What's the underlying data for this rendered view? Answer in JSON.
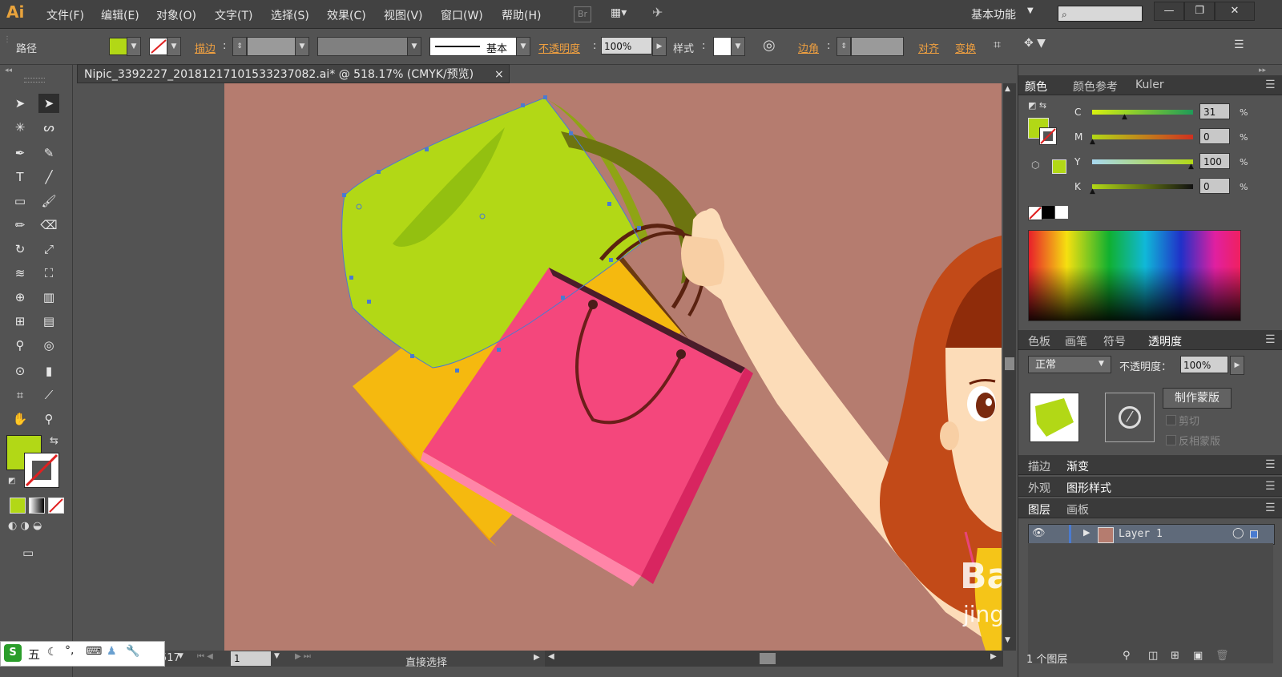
{
  "app": {
    "logo": "Ai",
    "workspace": "基本功能"
  },
  "menu": [
    "文件(F)",
    "编辑(E)",
    "对象(O)",
    "文字(T)",
    "选择(S)",
    "效果(C)",
    "视图(V)",
    "窗口(W)",
    "帮助(H)"
  ],
  "bridge_label": "Br",
  "window_buttons": [
    "—",
    "❐",
    "✕"
  ],
  "control": {
    "selection_type": "路径",
    "stroke_label": "描边",
    "stroke_profile": "基本",
    "opacity_label": "不透明度",
    "opacity_value": "100%",
    "style_label": "样式",
    "corner_label": "边角",
    "align_label": "对齐",
    "transform_label": "变换"
  },
  "document_tab": {
    "title": "Nipic_3392227_20181217101533237082.ai* @ 518.17% (CMYK/预览)",
    "close": "×"
  },
  "status": {
    "zoom": "517",
    "page": "1",
    "tool": "直接选择"
  },
  "colors": {
    "fill": "#b2d816",
    "artboard": "#b57c6f",
    "green_bag": "#b2d816",
    "yellow_bag": "#f5b90f",
    "pink_bag": "#f4477c"
  },
  "color_panel": {
    "tabs": [
      "颜色",
      "颜色参考",
      "Kuler"
    ],
    "channels": [
      {
        "name": "C",
        "value": "31",
        "pct": "%"
      },
      {
        "name": "M",
        "value": "0",
        "pct": "%"
      },
      {
        "name": "Y",
        "value": "100",
        "pct": "%"
      },
      {
        "name": "K",
        "value": "0",
        "pct": "%"
      }
    ]
  },
  "transparency_panel": {
    "tabs": [
      "色板",
      "画笔",
      "符号",
      "透明度"
    ],
    "mode": "正常",
    "opacity_label": "不透明度：",
    "opacity_value": "100%",
    "make_mask": "制作蒙版",
    "clip": "剪切",
    "invert": "反相蒙版"
  },
  "stroke_gradient_tabs": [
    "描边",
    "渐变"
  ],
  "appearance_tabs": [
    "外观",
    "图形样式"
  ],
  "layers_panel": {
    "tabs": [
      "图层",
      "画板"
    ],
    "layer_name": "Layer 1",
    "footer": "1 个图层"
  },
  "watermark": {
    "line1": "Ba",
    "line2": "jing"
  },
  "ime": {
    "mode": "五"
  }
}
